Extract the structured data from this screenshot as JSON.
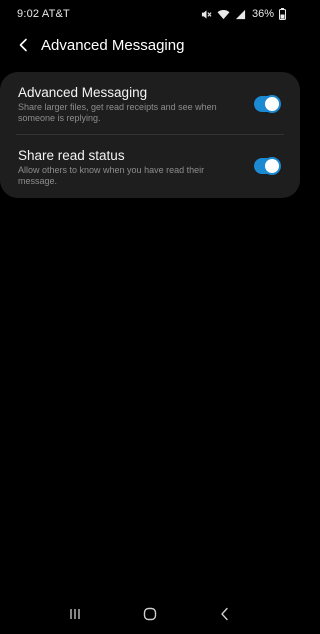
{
  "status_bar": {
    "time_carrier": "9:02 AT&T",
    "battery_percent": "36%",
    "icons": [
      "mute-icon",
      "wifi-icon",
      "signal-icon",
      "battery-icon"
    ]
  },
  "header": {
    "title": "Advanced Messaging",
    "back_icon": "back-arrow-icon"
  },
  "settings": [
    {
      "title": "Advanced Messaging",
      "description": "Share larger files, get read receipts and see when someone is replying.",
      "enabled": true
    },
    {
      "title": "Share read status",
      "description": "Allow others to know when you have read their message.",
      "enabled": true
    }
  ],
  "nav_bar": {
    "icons": [
      "recent-apps-icon",
      "home-icon",
      "back-icon"
    ]
  },
  "colors": {
    "background": "#000000",
    "card": "#1e1e1e",
    "accent": "#1b8ad2",
    "secondary_text": "#8d8d8d"
  }
}
